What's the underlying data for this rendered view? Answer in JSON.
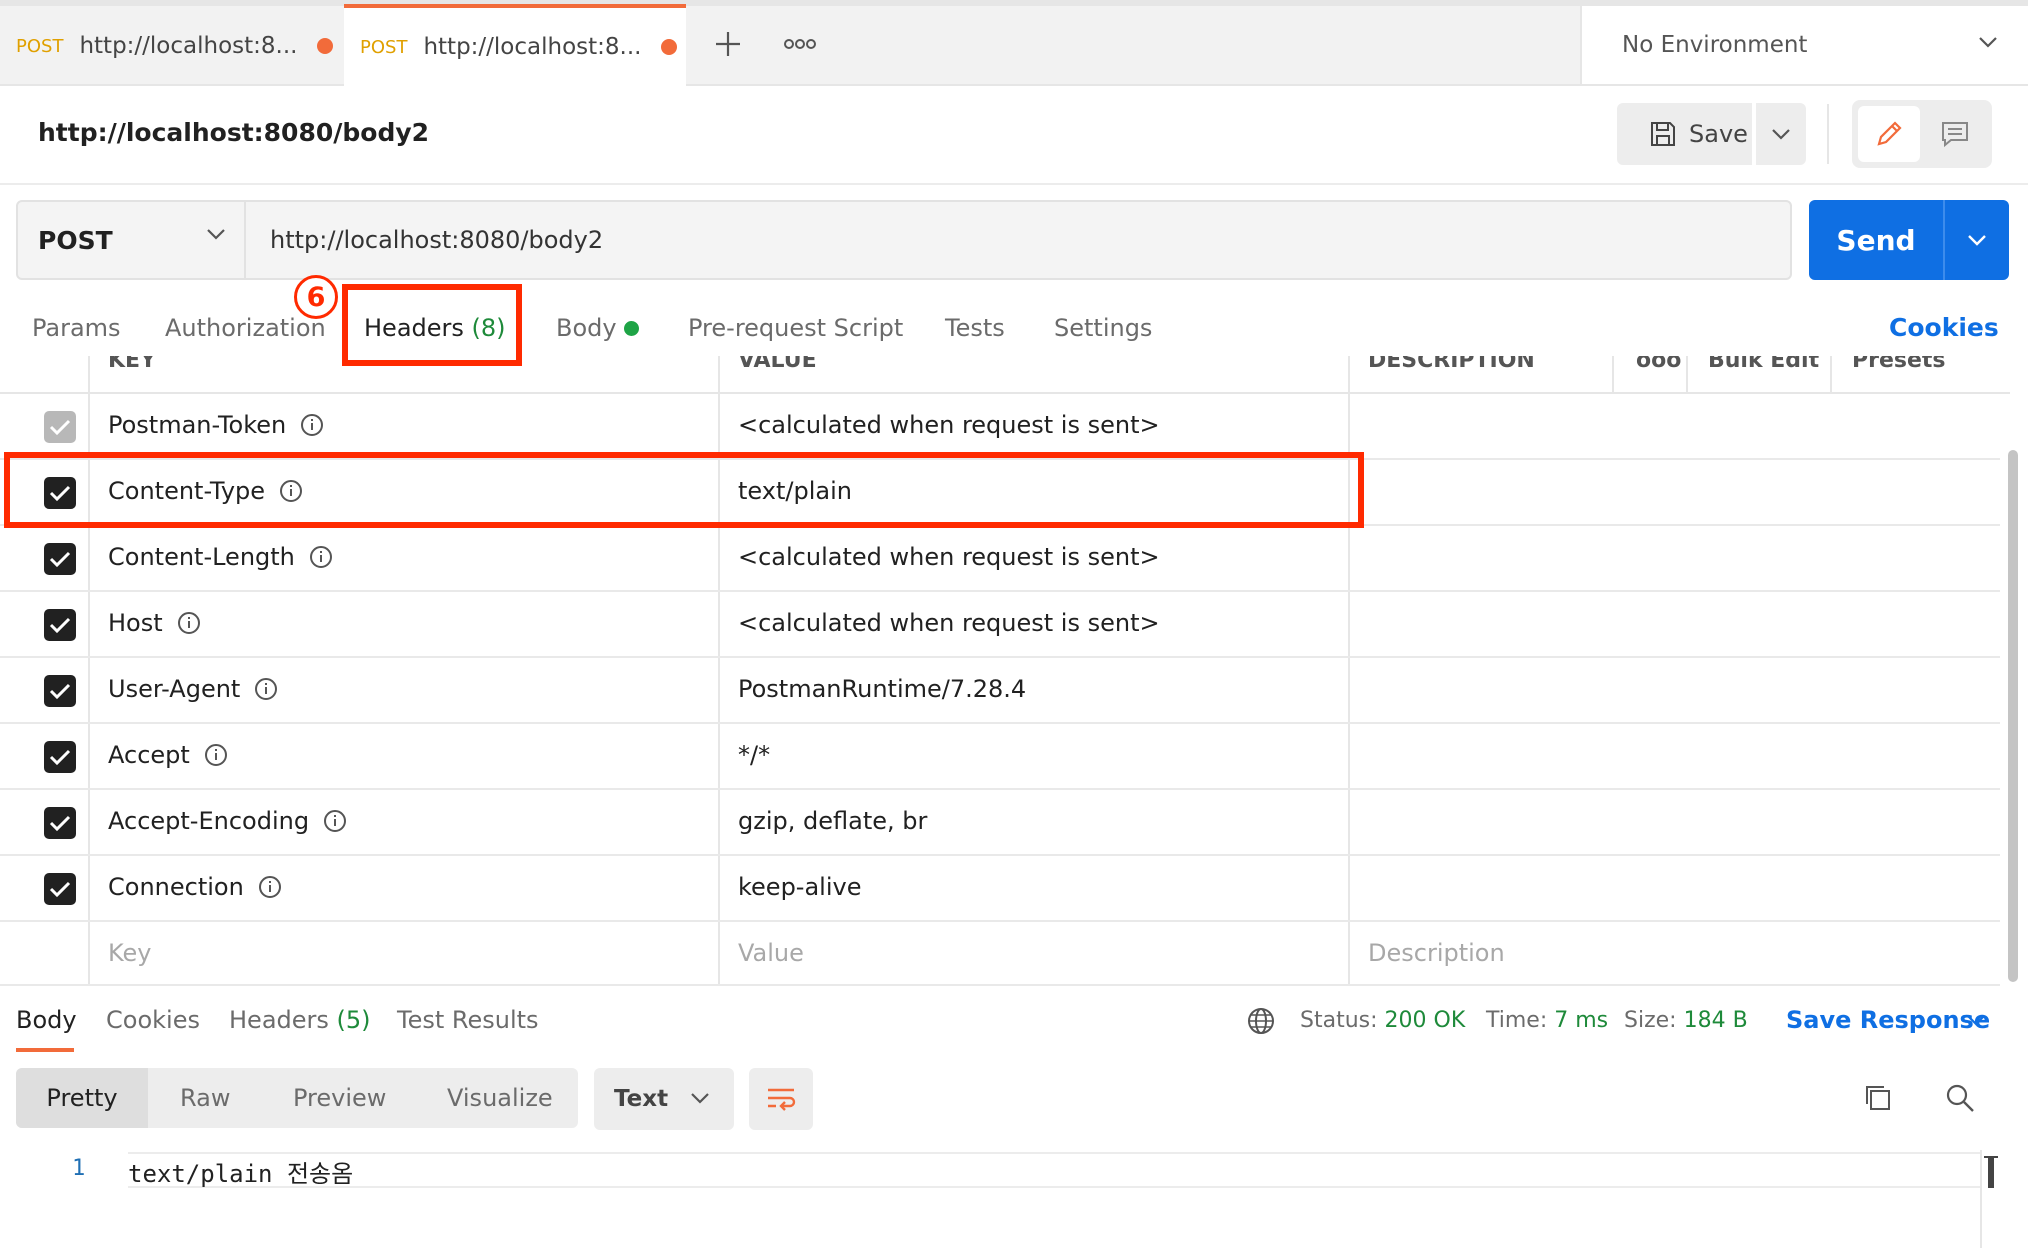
{
  "tabs": [
    {
      "method": "POST",
      "url": "http://localhost:8..."
    },
    {
      "method": "POST",
      "url": "http://localhost:8..."
    }
  ],
  "environment": "No Environment",
  "request": {
    "title": "http://localhost:8080/body2",
    "method": "POST",
    "url": "http://localhost:8080/body2",
    "save_label": "Save",
    "send_label": "Send"
  },
  "request_tabs": {
    "params": "Params",
    "authorization": "Authorization",
    "headers": "Headers",
    "headers_count": "(8)",
    "body": "Body",
    "prerequest": "Pre-request Script",
    "tests": "Tests",
    "settings": "Settings",
    "cookies": "Cookies"
  },
  "annotation_number": "6",
  "headers_table": {
    "columns": {
      "key": "KEY",
      "value": "VALUE",
      "description": "DESCRIPTION",
      "more": "ooo",
      "bulk_edit": "Bulk Edit",
      "presets": "Presets"
    },
    "rows": [
      {
        "key": "Postman-Token",
        "value": "<calculated when request is sent>"
      },
      {
        "key": "Content-Type",
        "value": "text/plain"
      },
      {
        "key": "Content-Length",
        "value": "<calculated when request is sent>"
      },
      {
        "key": "Host",
        "value": "<calculated when request is sent>"
      },
      {
        "key": "User-Agent",
        "value": "PostmanRuntime/7.28.4"
      },
      {
        "key": "Accept",
        "value": "*/*"
      },
      {
        "key": "Accept-Encoding",
        "value": "gzip, deflate, br"
      },
      {
        "key": "Connection",
        "value": "keep-alive"
      }
    ],
    "placeholder": {
      "key": "Key",
      "value": "Value",
      "description": "Description"
    }
  },
  "response": {
    "tabs": {
      "body": "Body",
      "cookies": "Cookies",
      "headers": "Headers",
      "headers_count": "(5)",
      "test_results": "Test Results"
    },
    "status_label": "Status:",
    "status_value": "200 OK",
    "time_label": "Time:",
    "time_value": "7 ms",
    "size_label": "Size:",
    "size_value": "184 B",
    "save_response": "Save Response",
    "formats": [
      "Pretty",
      "Raw",
      "Preview",
      "Visualize"
    ],
    "type": "Text",
    "line_number": "1",
    "code_line": "text/plain 전송옴"
  },
  "colors": {
    "accent": "#0f6fe3",
    "status_ok": "#1e8a3a",
    "annotation": "#ff2a00",
    "tab_dot": "#f26b3a"
  }
}
